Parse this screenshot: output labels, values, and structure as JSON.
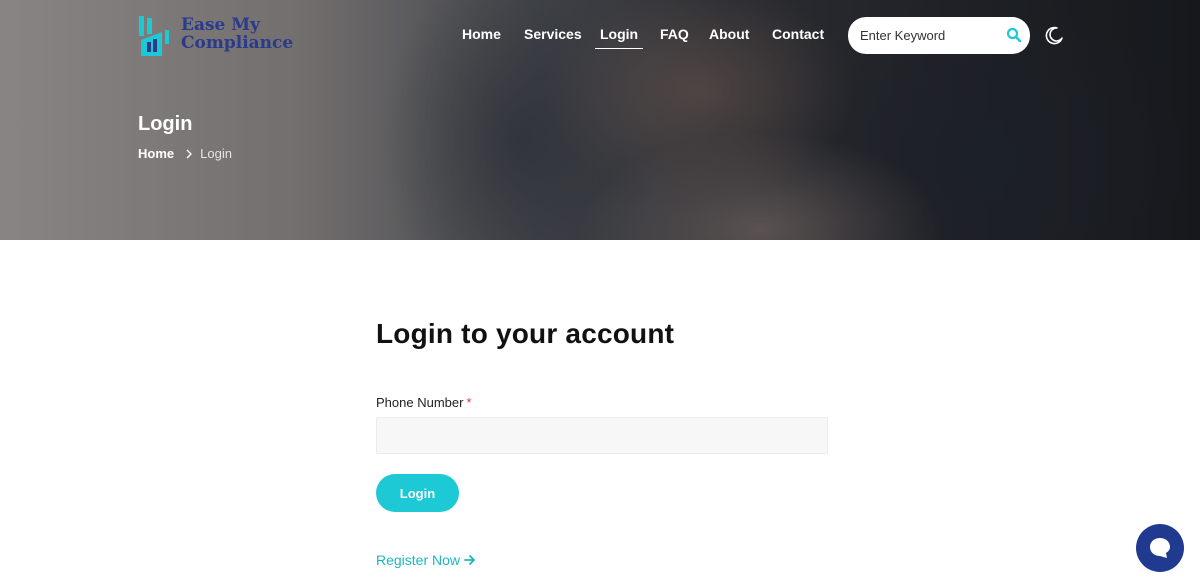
{
  "brand": {
    "line1": "Ease My",
    "line2": "Compliance",
    "accent": "#1ec9d6",
    "text_color": "#2a3a8c"
  },
  "nav": {
    "items": [
      {
        "label": "Home"
      },
      {
        "label": "Services"
      },
      {
        "label": "Login",
        "active": true
      },
      {
        "label": "FAQ"
      },
      {
        "label": "About"
      },
      {
        "label": "Contact"
      }
    ]
  },
  "search": {
    "placeholder": "Enter Keyword",
    "value": "",
    "icon": "search-icon"
  },
  "theme_toggle": {
    "icon": "moon-icon"
  },
  "hero": {
    "title": "Login",
    "breadcrumb": {
      "home": "Home",
      "current": "Login"
    }
  },
  "form": {
    "heading": "Login to your account",
    "phone_label": "Phone Number",
    "required_mark": "*",
    "phone_value": "",
    "submit_label": "Login",
    "register_label": "Register Now"
  },
  "chat": {
    "icon": "chat-bubble-icon",
    "color": "#1f3a8f"
  },
  "colors": {
    "button": "#1ec9d6",
    "link": "#1ab7c3",
    "required": "#e23a3a"
  }
}
